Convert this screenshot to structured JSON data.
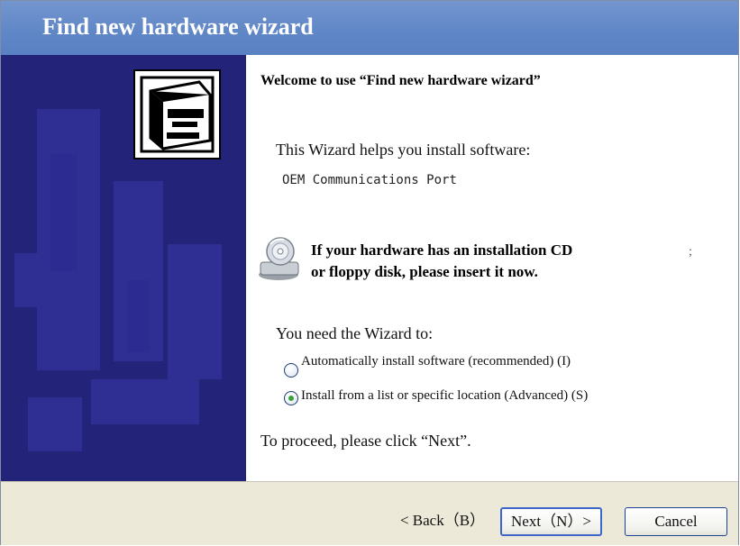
{
  "window": {
    "title": "Find new hardware wizard"
  },
  "content": {
    "welcome": "Welcome to use “Find new hardware wizard”",
    "helps": "This Wizard helps you install software:",
    "device": "OEM Communications Port",
    "cd_line1": "If your hardware has an installation CD",
    "cd_line2": "or floppy disk, please insert it now.",
    "stray_mark": ";",
    "need": "You need the Wizard to:",
    "options": [
      {
        "label": "Automatically install software (recommended) (I)",
        "selected": false
      },
      {
        "label": "Install from a list or specific location (Advanced) (S)",
        "selected": true
      }
    ],
    "proceed": "To proceed, please click “Next”."
  },
  "buttons": {
    "back": "< Back（B）",
    "next": "Next（N）>",
    "cancel": "Cancel"
  },
  "colors": {
    "titlebar": "#5f86c6",
    "side_panel": "#23237a",
    "footer": "#ece9d8",
    "radio_selected": "#3aa23a"
  },
  "icons": [
    "hardware-box-icon",
    "cd-drive-icon"
  ]
}
